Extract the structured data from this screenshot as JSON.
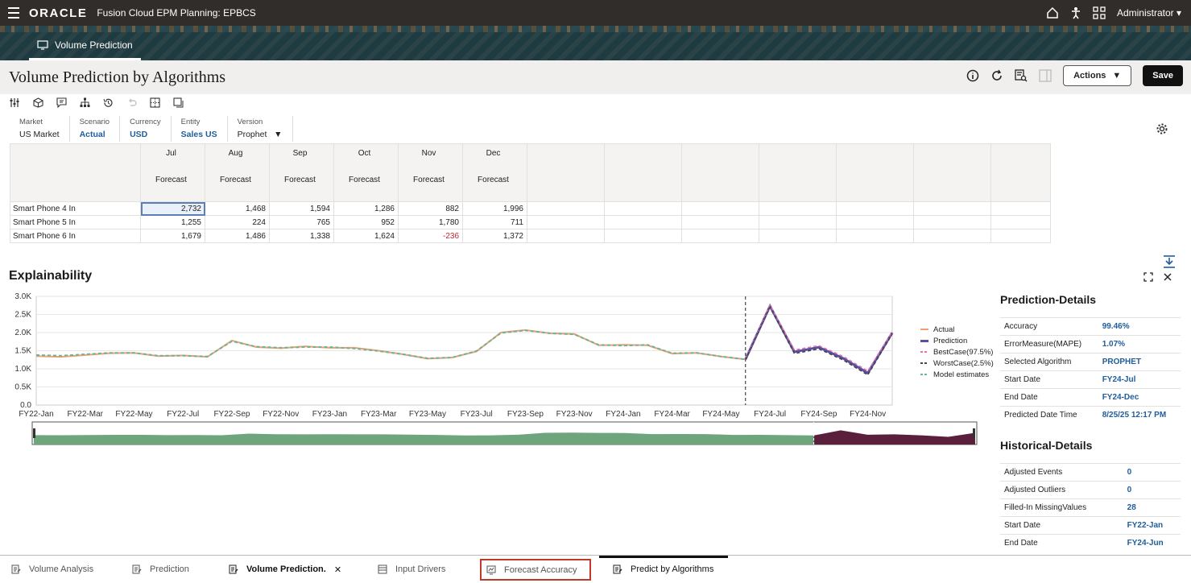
{
  "topbar": {
    "brand": "ORACLE",
    "app_title": "Fusion Cloud EPM Planning: EPBCS",
    "user": "Administrator"
  },
  "banner": {
    "tab_label": "Volume Prediction"
  },
  "page": {
    "title": "Volume Prediction by Algorithms",
    "actions_label": "Actions",
    "save_label": "Save"
  },
  "pov": [
    {
      "label": "Market",
      "value": "US Market",
      "link": false
    },
    {
      "label": "Scenario",
      "value": "Actual",
      "link": true
    },
    {
      "label": "Currency",
      "value": "USD",
      "link": true
    },
    {
      "label": "Entity",
      "value": "Sales US",
      "link": true
    },
    {
      "label": "Version",
      "value": "Prophet",
      "link": false
    }
  ],
  "grid": {
    "months": [
      "Jul",
      "Aug",
      "Sep",
      "Oct",
      "Nov",
      "Dec"
    ],
    "subheader": "Forecast",
    "rows": [
      {
        "label": "Smart Phone 4 In",
        "values": [
          "2,732",
          "1,468",
          "1,594",
          "1,286",
          "882",
          "1,996"
        ]
      },
      {
        "label": "Smart Phone 5 In",
        "values": [
          "1,255",
          "224",
          "765",
          "952",
          "1,780",
          "711"
        ]
      },
      {
        "label": "Smart Phone 6 In",
        "values": [
          "1,679",
          "1,486",
          "1,338",
          "1,624",
          "-236",
          "1,372"
        ]
      }
    ]
  },
  "explainability": {
    "title": "Explainability"
  },
  "chart_data": {
    "type": "line",
    "x": [
      "FY22-Jan",
      "FY22-Feb",
      "FY22-Mar",
      "FY22-Apr",
      "FY22-May",
      "FY22-Jun",
      "FY22-Jul",
      "FY22-Aug",
      "FY22-Sep",
      "FY22-Oct",
      "FY22-Nov",
      "FY22-Dec",
      "FY23-Jan",
      "FY23-Feb",
      "FY23-Mar",
      "FY23-Apr",
      "FY23-May",
      "FY23-Jun",
      "FY23-Jul",
      "FY23-Aug",
      "FY23-Sep",
      "FY23-Oct",
      "FY23-Nov",
      "FY23-Dec",
      "FY24-Jan",
      "FY24-Feb",
      "FY24-Mar",
      "FY24-Apr",
      "FY24-May",
      "FY24-Jun",
      "FY24-Jul",
      "FY24-Aug",
      "FY24-Sep",
      "FY24-Oct",
      "FY24-Nov",
      "FY24-Dec"
    ],
    "tick_labels": [
      "FY22-Jan",
      "FY22-Mar",
      "FY22-May",
      "FY22-Jul",
      "FY22-Sep",
      "FY22-Nov",
      "FY23-Jan",
      "FY23-Mar",
      "FY23-May",
      "FY23-Jul",
      "FY23-Sep",
      "FY23-Nov",
      "FY24-Jan",
      "FY24-Mar",
      "FY24-May",
      "FY24-Jul",
      "FY24-Sep",
      "FY24-Nov"
    ],
    "y_ticks": [
      "0.0",
      "0.5K",
      "1.0K",
      "1.5K",
      "2.0K",
      "2.5K",
      "3.0K"
    ],
    "ylim": [
      0,
      3000
    ],
    "series": [
      {
        "name": "Actual",
        "color": "#f0a070",
        "values": [
          1350,
          1330,
          1380,
          1430,
          1440,
          1350,
          1370,
          1330,
          1780,
          1600,
          1570,
          1620,
          1580,
          1580,
          1500,
          1400,
          1280,
          1310,
          1480,
          2000,
          2070,
          1980,
          1960,
          1650,
          1660,
          1650,
          1420,
          1440,
          1340,
          1260,
          null,
          null,
          null,
          null,
          null,
          null
        ]
      },
      {
        "name": "Prediction",
        "color": "#5a4fa0",
        "values": [
          null,
          null,
          null,
          null,
          null,
          null,
          null,
          null,
          null,
          null,
          null,
          null,
          null,
          null,
          null,
          null,
          null,
          null,
          null,
          null,
          null,
          null,
          null,
          null,
          null,
          null,
          null,
          null,
          null,
          1260,
          2732,
          1468,
          1594,
          1286,
          882,
          1996
        ]
      },
      {
        "name": "BestCase(97.5%)",
        "color": "#e870b0",
        "values": [
          null,
          null,
          null,
          null,
          null,
          null,
          null,
          null,
          null,
          null,
          null,
          null,
          null,
          null,
          null,
          null,
          null,
          null,
          null,
          null,
          null,
          null,
          null,
          null,
          null,
          null,
          null,
          null,
          null,
          1270,
          2760,
          1520,
          1640,
          1340,
          940,
          2030
        ]
      },
      {
        "name": "WorstCase(2.5%)",
        "color": "#444444",
        "values": [
          null,
          null,
          null,
          null,
          null,
          null,
          null,
          null,
          null,
          null,
          null,
          null,
          null,
          null,
          null,
          null,
          null,
          null,
          null,
          null,
          null,
          null,
          null,
          null,
          null,
          null,
          null,
          null,
          null,
          1250,
          2700,
          1420,
          1550,
          1240,
          830,
          1960
        ]
      },
      {
        "name": "Model estimates",
        "color": "#6ab59a",
        "values": [
          1380,
          1360,
          1400,
          1440,
          1440,
          1360,
          1360,
          1340,
          1760,
          1610,
          1580,
          1600,
          1600,
          1560,
          1490,
          1400,
          1290,
          1310,
          1490,
          1990,
          2060,
          1980,
          1950,
          1660,
          1640,
          1660,
          1430,
          1440,
          1340,
          1260,
          null,
          null,
          null,
          null,
          null,
          null
        ]
      }
    ],
    "forecast_start": "FY24-Jun",
    "legend_position": "right"
  },
  "prediction_details": {
    "title": "Prediction-Details",
    "rows": [
      {
        "label": "Accuracy",
        "value": "99.46%"
      },
      {
        "label": "ErrorMeasure(MAPE)",
        "value": "1.07%"
      },
      {
        "label": "Selected Algorithm",
        "value": "PROPHET"
      },
      {
        "label": "Start Date",
        "value": "FY24-Jul"
      },
      {
        "label": "End Date",
        "value": "FY24-Dec"
      },
      {
        "label": "Predicted Date Time",
        "value": "8/25/25 12:17 PM"
      }
    ]
  },
  "historical_details": {
    "title": "Historical-Details",
    "rows": [
      {
        "label": "Adjusted Events",
        "value": "0"
      },
      {
        "label": "Adjusted Outliers",
        "value": "0"
      },
      {
        "label": "Filled-In MissingValues",
        "value": "28"
      },
      {
        "label": "Start Date",
        "value": "FY22-Jan"
      },
      {
        "label": "End Date",
        "value": "FY24-Jun"
      }
    ]
  },
  "bottom_tabs": [
    {
      "label": "Volume Analysis"
    },
    {
      "label": "Prediction"
    },
    {
      "label": "Volume Prediction."
    },
    {
      "label": "Input Drivers"
    },
    {
      "label": "Forecast Accuracy"
    },
    {
      "label": "Predict by Algorithms"
    }
  ]
}
